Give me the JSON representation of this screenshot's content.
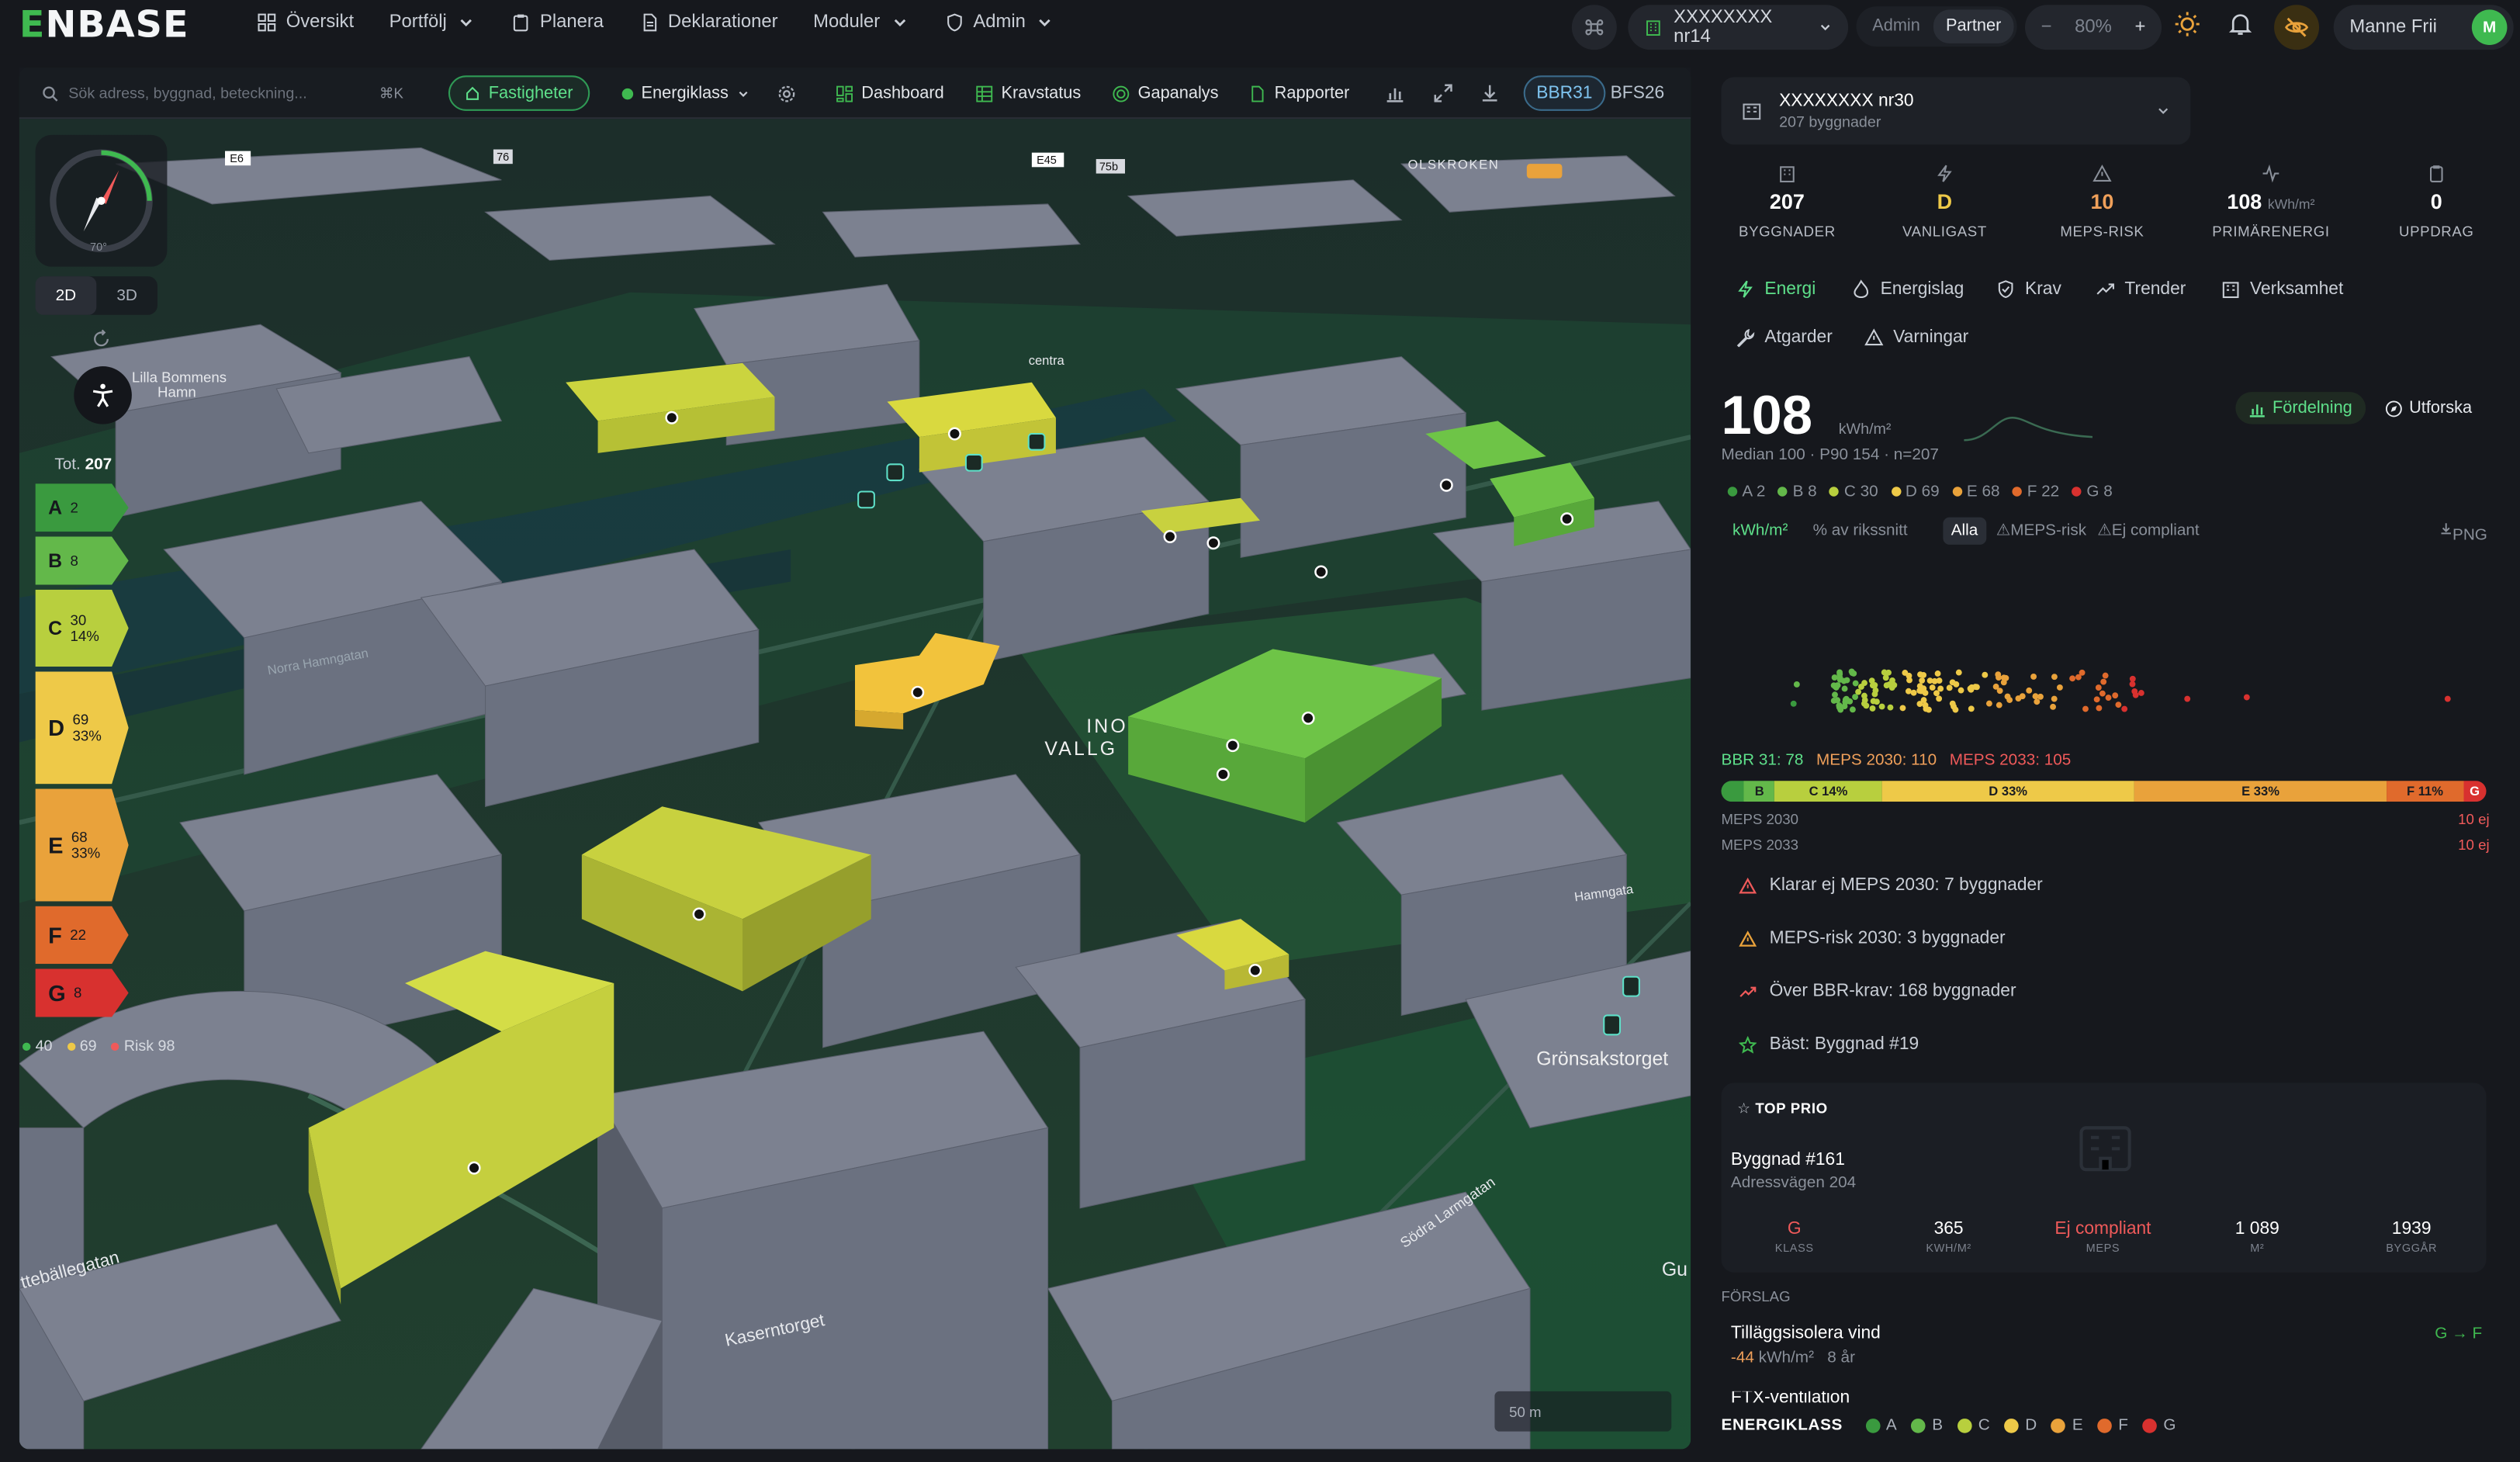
{
  "app": {
    "logo_first": "E",
    "logo_rest": "NBASE"
  },
  "nav": [
    {
      "label": "Översikt",
      "icon": "grid-icon"
    },
    {
      "label": "Portfölj",
      "icon": "chevron-down-icon"
    },
    {
      "label": "Planera",
      "icon": "clipboard-icon"
    },
    {
      "label": "Deklarationer",
      "icon": "document-icon"
    },
    {
      "label": "Moduler",
      "icon": "chevron-down-icon"
    },
    {
      "label": "Admin",
      "icon": "shield-icon"
    }
  ],
  "topright": {
    "project": "XXXXXXXX nr14",
    "roles": [
      "Admin",
      "Partner"
    ],
    "active_role": "Partner",
    "zoom_minus": "−",
    "zoom": "80%",
    "zoom_plus": "+",
    "user": "Manne Frii",
    "avatar": "M"
  },
  "toolbar": {
    "search_placeholder": "Sök adress, byggnad, beteckning...",
    "search_kbd": "⌘K",
    "fastigheter": "Fastigheter",
    "energiklass": "Energiklass",
    "dashboard": "Dashboard",
    "kravstatus": "Kravstatus",
    "gapanalys": "Gapanalys",
    "rapporter": "Rapporter",
    "bbr": "BBR31",
    "bfs": "BFS26"
  },
  "map": {
    "compass_tilt": "70°",
    "mode_2d": "2D",
    "mode_3d": "3D",
    "tot_label": "Tot.",
    "tot_value": "207",
    "classes": [
      {
        "letter": "A",
        "count": "2",
        "pct": "",
        "color": "#3a9a3f"
      },
      {
        "letter": "B",
        "count": "8",
        "pct": "",
        "color": "#63b84a"
      },
      {
        "letter": "C",
        "count": "30",
        "pct": "14%",
        "color": "#b8cf3e"
      },
      {
        "letter": "D",
        "count": "69",
        "pct": "33%",
        "color": "#eec948"
      },
      {
        "letter": "E",
        "count": "68",
        "pct": "33%",
        "color": "#e9a23b"
      },
      {
        "letter": "F",
        "count": "22",
        "pct": "",
        "color": "#e06a2c"
      },
      {
        "letter": "G",
        "count": "8",
        "pct": "",
        "color": "#d8312f"
      }
    ],
    "summary": [
      {
        "text": "40",
        "color": "#3fb950"
      },
      {
        "text": "69",
        "color": "#eec948"
      },
      {
        "text": "Risk 98",
        "color": "#f05a5a"
      }
    ],
    "labels": {
      "lilla": "Lilla Bommens",
      "hamn": "Hamn",
      "olskroken": "OLSKROKEN",
      "ino": "INO",
      "vallg": "VALLG",
      "gronsakstorget": "Grönsakstorget",
      "norra": "Norra Hamngatan",
      "kaser": "Kaserntorget",
      "sodra": "Södra Larmgatan",
      "tta": "ttebällegatan",
      "gu": "Gu",
      "hamng2": "Hamngata",
      "e6": "E6",
      "e45": "E45",
      "r76": "76",
      "r75": "75b",
      "centr": "centra"
    },
    "scale": "50 m"
  },
  "panel": {
    "project_title": "XXXXXXXX nr30",
    "project_sub": "207 byggnader",
    "kpis": [
      {
        "value": "207",
        "unit": "",
        "label": "BYGGNADER",
        "color": "#ffffff",
        "icon": "building-icon"
      },
      {
        "value": "D",
        "unit": "",
        "label": "VANLIGAST",
        "color": "#eec948",
        "icon": "bolt-icon"
      },
      {
        "value": "10",
        "unit": "",
        "label": "MEPS-RISK",
        "color": "#f0a05a",
        "icon": "warning-icon"
      },
      {
        "value": "108",
        "unit": "kWh/m²",
        "label": "PRIMÄRENERGI",
        "color": "#ffffff",
        "icon": "pulse-icon"
      },
      {
        "value": "0",
        "unit": "",
        "label": "UPPDRAG",
        "color": "#ffffff",
        "icon": "clipboard-icon"
      }
    ],
    "tabs": [
      "Energi",
      "Energislag",
      "Krav",
      "Trender",
      "Verksamhet",
      "Atgarder",
      "Varningar"
    ],
    "big_value": "108",
    "big_unit": "kWh/m²",
    "median_line": "Median 100 · P90 154 · n=207",
    "fordelning": "Fördelning",
    "utforska": "Utforska",
    "class_counts": [
      {
        "text": "A 2",
        "color": "#3a9a3f"
      },
      {
        "text": "B 8",
        "color": "#63b84a"
      },
      {
        "text": "C 30",
        "color": "#b8cf3e"
      },
      {
        "text": "D 69",
        "color": "#eec948"
      },
      {
        "text": "E 68",
        "color": "#e9a23b"
      },
      {
        "text": "F 22",
        "color": "#e06a2c"
      },
      {
        "text": "G 8",
        "color": "#d8312f"
      }
    ],
    "filters": {
      "kwh": "kWh/m²",
      "avrik": "% av rikssnitt",
      "alla": "Alla",
      "meps": "⚠MEPS-risk",
      "ejc": "⚠Ej compliant",
      "png": "PNG"
    },
    "thresholds": [
      {
        "text": "BBR 31: 78",
        "color": "#5ee08a"
      },
      {
        "text": "MEPS 2030: 110",
        "color": "#f0a05a"
      },
      {
        "text": "MEPS 2033: 105",
        "color": "#f05a5a"
      }
    ],
    "dist": [
      {
        "label": "",
        "pct": 3,
        "color": "#3a9a3f"
      },
      {
        "label": "B",
        "pct": 4,
        "color": "#63b84a"
      },
      {
        "label": "C 14%",
        "pct": 14,
        "color": "#b8cf3e"
      },
      {
        "label": "D 33%",
        "pct": 33,
        "color": "#eec948"
      },
      {
        "label": "E 33%",
        "pct": 33,
        "color": "#e9a23b"
      },
      {
        "label": "F 11%",
        "pct": 10,
        "color": "#e06a2c"
      },
      {
        "label": "G",
        "pct": 3,
        "color": "#d8312f"
      }
    ],
    "meps2030": "MEPS 2030",
    "meps2030_r": "10 ej",
    "meps2033": "MEPS 2033",
    "meps2033_r": "10 ej",
    "alerts": [
      "Klarar ej MEPS 2030: 7 byggnader",
      "MEPS-risk 2030: 3 byggnader",
      "Över BBR-krav: 168 byggnader",
      "Bäst: Byggnad #19"
    ],
    "top_prio": "TOP PRIO",
    "prio_name": "Byggnad #161",
    "prio_addr": "Adressvägen 204",
    "prio_stats": [
      {
        "value": "G",
        "label": "KLASS",
        "color": "#f05a5a"
      },
      {
        "value": "365",
        "label": "KWH/M²",
        "color": "#ffffff"
      },
      {
        "value": "Ej compliant",
        "label": "MEPS",
        "color": "#f05a5a"
      },
      {
        "value": "1 089",
        "label": "M²",
        "color": "#ffffff"
      },
      {
        "value": "1939",
        "label": "BYGGÅR",
        "color": "#ffffff"
      }
    ],
    "forslag": "FÖRSLAG",
    "action": "Tilläggsisolera vind",
    "action_kwh": "-44",
    "action_kwh_unit": "kWh/m²",
    "action_years": "8 år",
    "action_grade": "G → F",
    "action_next": "FTX-ventilation",
    "energiklass": "ENERGIKLASS",
    "legend": [
      "A",
      "B",
      "C",
      "D",
      "E",
      "F",
      "G"
    ]
  }
}
